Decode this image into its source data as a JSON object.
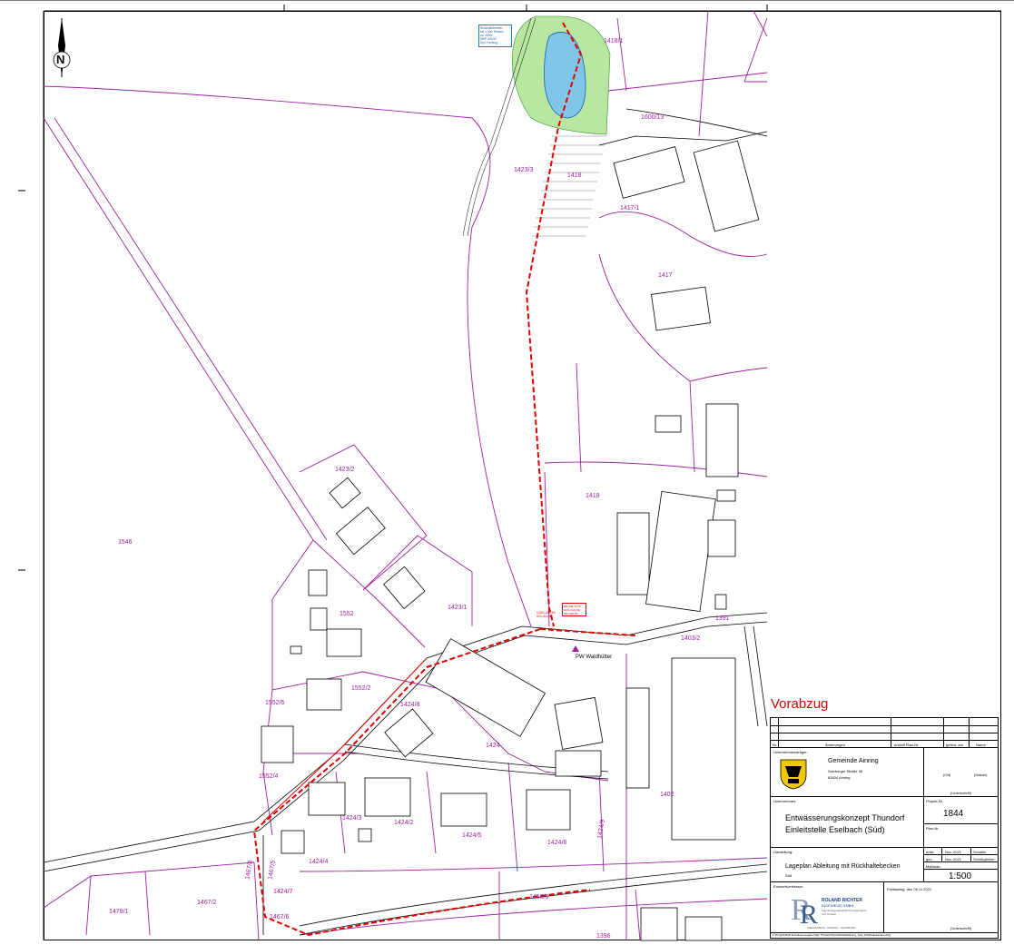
{
  "north_arrow": {
    "letter": "N"
  },
  "drafting_note": "Vorabzug",
  "parcels": [
    {
      "id": "1418/1"
    },
    {
      "id": "1600/13"
    },
    {
      "id": "1423/3"
    },
    {
      "id": "1418"
    },
    {
      "id": "1417/1"
    },
    {
      "id": "1417"
    },
    {
      "id": "1546"
    },
    {
      "id": "1423/2"
    },
    {
      "id": "1419"
    },
    {
      "id": "1423/1"
    },
    {
      "id": "1552"
    },
    {
      "id": "1552/2"
    },
    {
      "id": "1552/5"
    },
    {
      "id": "1552/4"
    },
    {
      "id": "1424/8"
    },
    {
      "id": "1424"
    },
    {
      "id": "1424/3"
    },
    {
      "id": "1424/2"
    },
    {
      "id": "1424/5"
    },
    {
      "id": "1424/6"
    },
    {
      "id": "1424/4"
    },
    {
      "id": "1424/9"
    },
    {
      "id": "1403/2"
    },
    {
      "id": "1402"
    },
    {
      "id": "1467/3"
    },
    {
      "id": "1467/5"
    },
    {
      "id": "1467/2"
    },
    {
      "id": "1479/1"
    },
    {
      "id": "1467/6"
    },
    {
      "id": "1456/6"
    },
    {
      "id": "1424/7"
    },
    {
      "id": "1391"
    },
    {
      "id": "1396"
    }
  ],
  "annotations": {
    "pump_station": "PW Waldhütter",
    "red_box_lines": [
      "DN 200 / 0,35",
      "GOK=424,80",
      "SO=422,60"
    ],
    "red_label_a": "GOK=424,80",
    "red_label_b": "SO=422,60",
    "info_box_lines": [
      "Rückhaltebecken",
      "bei 1,00m Rinsten",
      "ca. 400m³",
      "WSP 443,50",
      "Dipl. Freiburg"
    ]
  },
  "title_block": {
    "revision_headers": [
      "Nr.",
      "Änderungen",
      "erstellt Plan-Nr.",
      "geänd. am",
      "Name"
    ],
    "client_label": "Unternehmensträger:",
    "client_name": "Gemeinde Ainring",
    "client_address_1": "Salzburger Straße 48",
    "client_address_2": "83404 Ainring",
    "ort_label": "(Ort)",
    "datum_label": "(Datum)",
    "signature_label": "(Unterschrift)",
    "contractor_label": "Unternehmen:",
    "project_title_1": "Entwässerungskonzept Thundorf",
    "project_title_2": "Einleitstelle Eselbach (Süd)",
    "project_no_label": "Projekt-Nr.",
    "project_no": "1844",
    "plan_no_label": "Plan-Nr.",
    "plan_no": "",
    "display_label": "Darstellung:",
    "display_title": "Lageplan Ableitung mit Rückhaltebecken",
    "display_sub": "Süd",
    "rows": [
      {
        "label": "entw.",
        "date": "Nov. 2021",
        "name": "Schaller"
      },
      {
        "label": "gez.",
        "date": "Nov. 2021",
        "name": "Schöbgfohler"
      }
    ],
    "scale_label": "Maßstab:",
    "scale": "1:500",
    "planner_label": "Entwurfsverfasser:",
    "company_name_1": "ROLAND RICHTER",
    "company_name_2": "INGENIEUR GMBH",
    "company_sub": "Ingenieurgesellschaft für Infrastruktur und Umwelt",
    "company_places": "FREILASSING - PASSAU - SALZBURG",
    "signed_place_date": "Freilassing, den 09.11.2021",
    "signature_label_2": "(Unterschrift)",
    "file_path": "L:\\Projekt\\1844 Entwässerungskonzept Thundorf\\Acad\\Süd\\Ableitung_Süd_Rückhaltebecken.dwg"
  },
  "colors": {
    "parcel": "#a020a0",
    "pipe": "#e00000",
    "pond": "#7fc6e8",
    "green": "#b9e6a0",
    "building": "#000000"
  }
}
